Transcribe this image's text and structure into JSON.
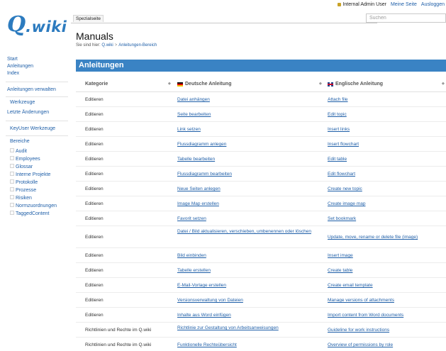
{
  "header": {
    "user": "Internal Admin User",
    "links": [
      "Meine Seite",
      "Ausloggen"
    ],
    "logo_q": "Q",
    "logo_wiki": ".wiki",
    "tab_label": "Spezialseite",
    "search_placeholder": "Suchen"
  },
  "sidebar": {
    "top_links": [
      "Start",
      "Anleitungen",
      "Index"
    ],
    "manage_link": "Anleitungen verwalten",
    "tools": "Werkzeuge",
    "recent_changes": "Letzte Änderungen",
    "keyuser_tools": "KeyUser Werkzeuge",
    "areas_label": "Bereiche",
    "areas": [
      "Audit",
      "Employees",
      "Glossar",
      "Interne Projekte",
      "Protokolle",
      "Prozesse",
      "Risiken",
      "Normzuordnungen",
      "TaggedContent"
    ]
  },
  "main": {
    "title": "Manuals",
    "breadcrumb": {
      "prefix": "Sie sind hier:",
      "items": [
        "Q.wiki",
        "Anleitungen-Bereich"
      ]
    },
    "section_title": "Anleitungen",
    "table": {
      "headers": [
        "Kategorie",
        "Deutsche Anleitung",
        "Englische Anleitung"
      ],
      "rows": [
        {
          "kat": "Editieren",
          "de": "Datei anhängen",
          "en": "Attach file"
        },
        {
          "kat": "Editieren",
          "de": "Seite bearbeiten",
          "en": "Edit topic"
        },
        {
          "kat": "Editieren",
          "de": "Link setzen",
          "en": "Insert links"
        },
        {
          "kat": "Editieren",
          "de": "Flussdiagramm anlegen",
          "en": "Insert flowchart"
        },
        {
          "kat": "Editieren",
          "de": "Tabelle bearbeiten",
          "en": "Edit table"
        },
        {
          "kat": "Editieren",
          "de": "Flussdiagramm bearbeiten",
          "en": "Edit flowchart"
        },
        {
          "kat": "Editieren",
          "de": "Neue Seiten anlegen",
          "en": "Create new topic"
        },
        {
          "kat": "Editieren",
          "de": "Image Map erstellen",
          "en": "Create image map"
        },
        {
          "kat": "Editieren",
          "de": "Favorit setzen",
          "en": "Set bookmark"
        },
        {
          "kat": "Editieren",
          "de": "Datei / Bild aktualisieren, verschieben, umbenennen oder löschen",
          "en": "Update, move, rename or delete file (image)"
        },
        {
          "kat": "Editieren",
          "de": "Bild einbinden",
          "en": "Insert image"
        },
        {
          "kat": "Editieren",
          "de": "Tabelle erstellen",
          "en": "Create table"
        },
        {
          "kat": "Editieren",
          "de": "E-Mail-Vorlage erstellen",
          "en": "Create email template"
        },
        {
          "kat": "Editieren",
          "de": "Versionsverwaltung von Dateien",
          "en": "Manage versions of attachments"
        },
        {
          "kat": "Editieren",
          "de": "Inhalte aus Word einfügen",
          "en": "Import content from Word documents"
        },
        {
          "kat": "Richtlinien und Rechte im Q.wiki",
          "de": "Richtlinie zur Gestaltung von Arbeitsanweisungen",
          "en": "Guideline for work instructions"
        },
        {
          "kat": "Richtlinien und Rechte im Q.wiki",
          "de": "Funktionelle Rechteübersicht",
          "en": "Overview of permissions by role"
        }
      ]
    }
  },
  "colors": {
    "accent": "#3a83c4",
    "link": "#1f5fa8",
    "logo": "#2c7bbf"
  }
}
